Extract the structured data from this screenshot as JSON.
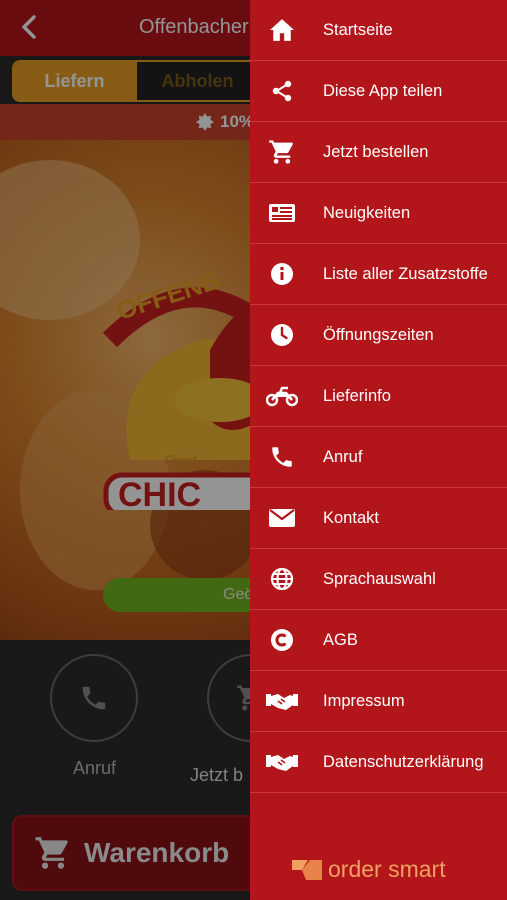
{
  "header": {
    "title": "Offenbacher",
    "back_icon": "chevron-left-icon"
  },
  "order_mode": {
    "deliver_label": "Liefern",
    "pickup_label": "Abholen"
  },
  "promo": {
    "text": "10%"
  },
  "hero": {
    "status_button_label": "Geö",
    "logo_text_1": "OFFENB",
    "logo_text_2": "CHIC",
    "logo_text_3": "Fried"
  },
  "actions": [
    {
      "label": "Anruf",
      "icon": "phone-icon"
    },
    {
      "label": "Jetzt b",
      "icon": "cart-icon"
    }
  ],
  "cart_button": {
    "label": "Warenkorb",
    "icon": "cart-icon"
  },
  "menu": [
    {
      "label": "Startseite",
      "icon": "home-icon"
    },
    {
      "label": "Diese App teilen",
      "icon": "share-icon"
    },
    {
      "label": "Jetzt bestellen",
      "icon": "cart-icon"
    },
    {
      "label": "Neuigkeiten",
      "icon": "news-icon"
    },
    {
      "label": "Liste aller Zusatzstoffe",
      "icon": "info-icon"
    },
    {
      "label": "Öffnungszeiten",
      "icon": "clock-icon"
    },
    {
      "label": "Lieferinfo",
      "icon": "motorbike-icon"
    },
    {
      "label": "Anruf",
      "icon": "phone-icon"
    },
    {
      "label": "Kontakt",
      "icon": "envelope-icon"
    },
    {
      "label": "Sprachauswahl",
      "icon": "globe-icon"
    },
    {
      "label": "AGB",
      "icon": "copyright-icon"
    },
    {
      "label": "Impressum",
      "icon": "handshake-icon"
    },
    {
      "label": "Datenschutzerklärung",
      "icon": "handshake-icon"
    }
  ],
  "brand": {
    "name": "order smart"
  },
  "colors": {
    "primary": "#b3161a",
    "accent": "#e8a126",
    "green": "#6fb51f"
  }
}
